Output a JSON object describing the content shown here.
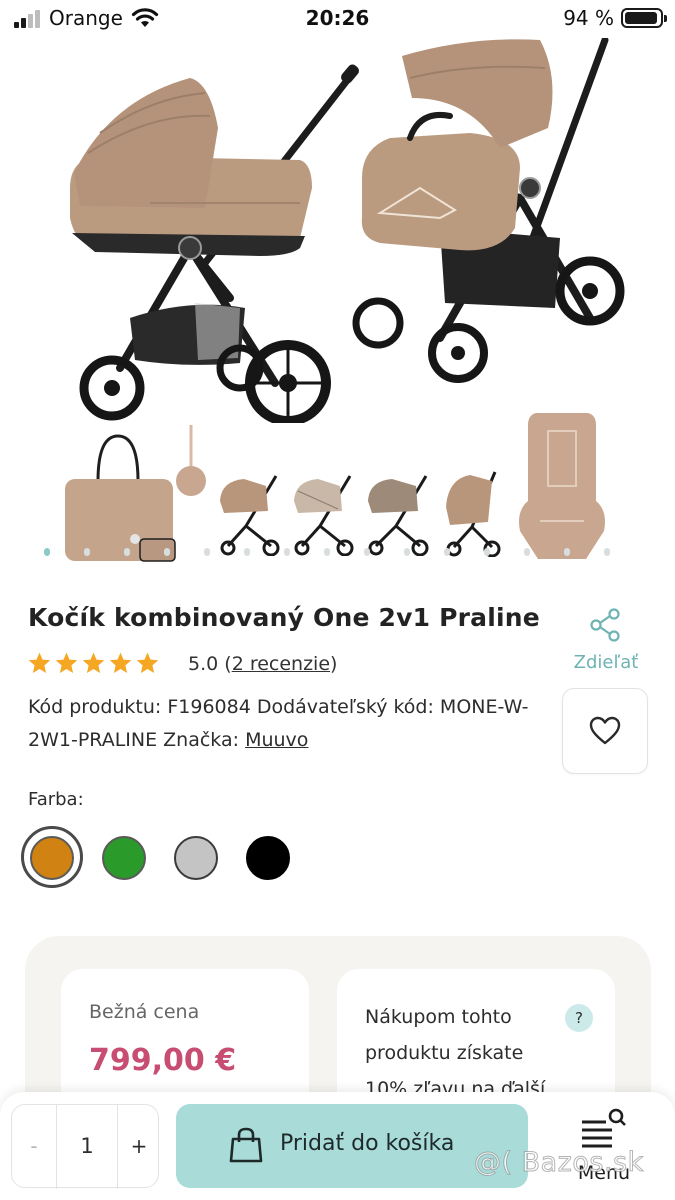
{
  "status_bar": {
    "carrier": "Orange",
    "time": "20:26",
    "battery": "94 %",
    "battery_level": 0.94
  },
  "gallery": {
    "slide_count": 15,
    "active_slide": 0
  },
  "product": {
    "title": "Kočík kombinovaný One 2v1 Praline",
    "rating_value": "5.0",
    "rating_stars": 5,
    "reviews_open": "(",
    "reviews_link": "2 recenzie",
    "reviews_close": ")",
    "codes_text": "Kód produktu: F196084 Dodávateľský kód: MONE-W-2W1-PRALINE Značka: ",
    "brand": "Muuvo"
  },
  "share": {
    "label": "Zdieľať",
    "icon": "share-icon"
  },
  "wishlist": {
    "icon": "heart-icon"
  },
  "colors": {
    "label": "Farba:",
    "options": [
      {
        "name": "orange",
        "hex": "#d08312",
        "selected": true
      },
      {
        "name": "green",
        "hex": "#2a9a2a",
        "selected": false
      },
      {
        "name": "gray",
        "hex": "#c4c4c4",
        "selected": false
      },
      {
        "name": "black",
        "hex": "#000000",
        "selected": false
      }
    ]
  },
  "pricing": {
    "regular_label": "Bežná cena",
    "regular_price": "799,00 €",
    "promo_text": "Nákupom tohto produktu získate 10% zľavu na ďalší",
    "help_symbol": "?"
  },
  "bottom_bar": {
    "qty_minus": "-",
    "qty_value": "1",
    "qty_plus": "+",
    "add_to_cart": "Pridať do košíka",
    "menu_label": "Menu"
  },
  "watermark": "@( Bazos.sk",
  "accent_colors": {
    "teal": "#6fb3b3",
    "cart_button": "#a9dbd9",
    "price": "#c74d72",
    "star": "#f5a623"
  }
}
